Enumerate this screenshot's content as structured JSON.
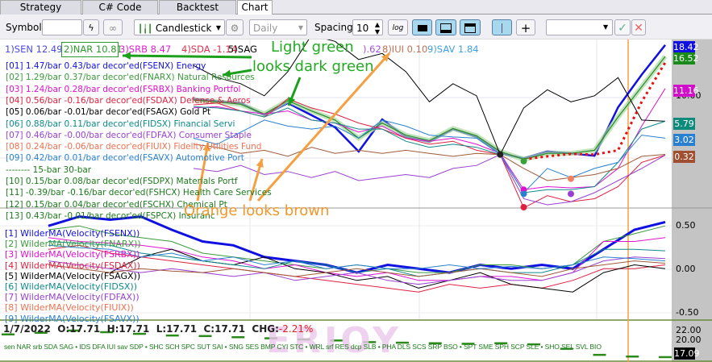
{
  "tabs": [
    {
      "label": "Strategy Settings"
    },
    {
      "label": "C# Code Editor"
    },
    {
      "label": "Backtest Results"
    },
    {
      "label": "Chart",
      "active": true
    }
  ],
  "toolbar": {
    "symbol_label": "Symbol",
    "symbol_value": "",
    "chart_type": "Candlestick",
    "period": "Daily",
    "spacing_label": "Spacing",
    "spacing_value": "10",
    "log_label": "log",
    "right_select": ""
  },
  "top_legend": [
    {
      "text": "1)SEN 12.49",
      "color": "#4a4ae0"
    },
    {
      "text": "2)NAR 10.81",
      "color": "#2a9a2a"
    },
    {
      "text": "3)SRB 8.47",
      "color": "#e020d0"
    },
    {
      "text": "4)SDA -1.14",
      "color": "#e03050"
    },
    {
      "text": "5)SAG",
      "color": "#000000"
    },
    {
      "text": ").62",
      "color": "#a050e0"
    },
    {
      "text": "8)IUI 0.10",
      "color": "#c07050"
    },
    {
      "text": "9)SAV 1.84",
      "color": "#40a0e0"
    }
  ],
  "upper_legend": [
    {
      "text": "[01]  1.47/bar  0.43/bar  decor'ed(FSENX) Energy",
      "color": "#1010e0"
    },
    {
      "text": "[02]  1.29/bar  0.37/bar  decor'ed(FNARX) Natural Resources",
      "color": "#3a9a3a"
    },
    {
      "text": "[03]  1.24/bar  0.28/bar  decor'ed(FSRBX) Banking Portfol",
      "color": "#e010d0"
    },
    {
      "text": "[04]  0.56/bar -0.16/bar  decor'ed(FSDAX) Defense & Aeros",
      "color": "#e02040"
    },
    {
      "text": "[05]  0.06/bar -0.01/bar  decor'ed(FSAGX) Gold Pt",
      "color": "#000000"
    },
    {
      "text": "[06]  0.88/bar  0.11/bar  decor'ed(FIDSX) Financial Servi",
      "color": "#0e8a8a"
    },
    {
      "text": "[07]  0.46/bar -0.00/bar  decor'ed(FDFAX) Consumer Staple",
      "color": "#9a40d0"
    },
    {
      "text": "[08]  0.24/bar -0.06/bar  decor'ed(FIUIX) Fidelity Utilities Fund",
      "color": "#f07050"
    },
    {
      "text": "[09]  0.42/bar  0.01/bar  decor'ed(FSAVX) Automotive Port",
      "color": "#2a80d0"
    },
    {
      "text": "-------- 15-bar    30-bar",
      "color": "#1a7a1a"
    },
    {
      "text": "[10]  0.15/bar  0.08/bar  decor'ed(FSDPX) Materials Portf",
      "color": "#1a7a1a"
    },
    {
      "text": "[11] -0.39/bar -0.16/bar  decor'ed(FSHCX) Health Care Services",
      "color": "#1a7a1a"
    },
    {
      "text": "[12]  0.15/bar  0.04/bar  decor'ed(FSCHX) Chemical Pt",
      "color": "#1a7a1a"
    },
    {
      "text": "[13]  0.43/bar -0.01/bar  decor'ed(FSPCX) Insuranc",
      "color": "#1a7a1a"
    }
  ],
  "lower_legend": [
    {
      "text": "[1] WilderMA(Velocity(FSENX))",
      "color": "#1010e0"
    },
    {
      "text": "[2] WilderMA(Velocity(FNARX))",
      "color": "#3a9a3a"
    },
    {
      "text": "[3] WilderMA(Velocity(FSRBX))",
      "color": "#e010d0"
    },
    {
      "text": "[4] WilderMA(Velocity(FSDAX))",
      "color": "#e02040"
    },
    {
      "text": "[5] WilderMA(Velocity(FSAGX))",
      "color": "#000000"
    },
    {
      "text": "[6] WilderMA(Velocity(FIDSX))",
      "color": "#0e8a8a"
    },
    {
      "text": "[7] WilderMA(Velocity(FDFAX))",
      "color": "#9a40d0"
    },
    {
      "text": "[8] WilderMA(Velocity(FIUIX))",
      "color": "#f07050"
    },
    {
      "text": "[9] WilderMA(Velocity(FSAVX))",
      "color": "#2a80d0"
    }
  ],
  "ohlc": {
    "date": "1/7/2022",
    "open": "O:17.71",
    "high": "H:17.71",
    "low": "L:17.71",
    "close": "C:17.71",
    "chg_label": "CHG:",
    "chg_value": "-2.21%"
  },
  "symbols_line": "sen NAR srb SDA SAG • IDS DFA IUI sav SDP • SHC SCH SPC SUT SAI • SNG SES BMP CYI STC • WRL srf RES dcp SLB • PHA DLS SCS SRP BSO • SPT SME SPH SCP SLE • SHO SEL SVL BIO",
  "watermark": "ERIOY",
  "upper_axis": {
    "labels": [
      "10.00"
    ],
    "tags": [
      {
        "text": "18.42",
        "color": "#1010e0",
        "value": 18.42
      },
      {
        "text": "16.52",
        "color": "#1a8a1a",
        "value": 16.52
      },
      {
        "text": "11.16",
        "color": "#d010c8",
        "value": 11.16
      },
      {
        "text": "5.79",
        "color": "#0e8a7a",
        "value": 5.79
      },
      {
        "text": "3.02",
        "color": "#2a80d0",
        "value": 3.02
      },
      {
        "text": "0.32",
        "color": "#a05030",
        "value": 0.32
      }
    ]
  },
  "lower_axis": {
    "labels": [
      "0.50",
      "0.00",
      "-0.50"
    ]
  },
  "bottom_axis": {
    "labels": [
      "22.00",
      "20.00"
    ],
    "current": "17.09"
  },
  "annotations": {
    "light_green": "Light green",
    "dark_green": "looks dark green",
    "orange_brown": "Orange looks brown"
  },
  "chart_data": {
    "type": "line",
    "upper": {
      "ylim": [
        -8.4,
        19.3
      ],
      "series": [
        {
          "name": "FSENX",
          "color": "#1010e0",
          "width": 2.5,
          "values": [
            9.5,
            9.1,
            8.8,
            6.8,
            8.8,
            6.8,
            4.8,
            0.8,
            6.1,
            3.2,
            2.4,
            4.5,
            3.2,
            0.5,
            -0.3,
            0.8,
            0.5,
            0.1,
            8.1,
            13.5,
            18.4
          ]
        },
        {
          "name": "FNARX",
          "color": "#2a8a2a",
          "width": 1.2,
          "halo": true,
          "values": [
            9.3,
            9.0,
            8.6,
            7.0,
            9.2,
            7.5,
            6.0,
            3.0,
            5.5,
            3.5,
            2.6,
            4.6,
            3.4,
            0.8,
            -0.5,
            0.5,
            0.5,
            1.0,
            6.5,
            11.5,
            16.5
          ]
        },
        {
          "name": "FSRBX",
          "color": "#e010d0",
          "width": 1,
          "values": [
            8.0,
            8.2,
            7.5,
            7.0,
            7.5,
            6.0,
            5.5,
            4.0,
            5.0,
            3.0,
            2.5,
            3.0,
            2.0,
            0.5,
            -5.5,
            -5.0,
            -5.2,
            -5.0,
            -2,
            5,
            11.2
          ]
        },
        {
          "name": "FSDAX",
          "color": "#e02040",
          "width": 1,
          "values": [
            8.5,
            8.8,
            7.5,
            6.5,
            9.5,
            8.0,
            7.0,
            5.5,
            4.5,
            3.0,
            2.0,
            2.5,
            1.0,
            0.3,
            -8.5,
            -6.5,
            -7.5,
            -7.0,
            -5.0,
            -1.0,
            0.2
          ]
        },
        {
          "name": "FSAGX",
          "color": "#000000",
          "width": 1,
          "values": [
            15,
            13,
            12,
            10,
            14,
            20,
            19,
            16,
            17,
            14,
            9,
            12,
            10,
            0.3,
            8,
            11,
            9,
            10,
            13,
            6,
            5.8
          ]
        },
        {
          "name": "FIDSX",
          "color": "#0e8a8a",
          "width": 1,
          "values": [
            8.2,
            8.0,
            7.5,
            6.5,
            8.0,
            6.0,
            5.5,
            4.5,
            4.5,
            2.5,
            1.5,
            2.0,
            1.5,
            0.3,
            -6.0,
            -5.5,
            -5.5,
            -5.0,
            -1.0,
            4.5,
            5.8
          ]
        },
        {
          "name": "FDFAX",
          "color": "#9a40d0",
          "width": 1,
          "values": [
            -2.0,
            -2.5,
            -1.5,
            -3.0,
            -2.5,
            -3.5,
            -2.5,
            -4.0,
            -3.5,
            -3.0,
            -3.5,
            -2.0,
            -1.5,
            0.3,
            -7,
            -8,
            -7.5,
            -6,
            -4,
            -2,
            0.2
          ]
        },
        {
          "name": "FIUIX",
          "color": "#a05a3a",
          "width": 1,
          "values": [
            2,
            1.5,
            0.5,
            1.0,
            0,
            1.5,
            0.5,
            1.0,
            0.5,
            1.0,
            0.5,
            0,
            0.5,
            0.3,
            -2,
            -4,
            -3.5,
            -3,
            -2,
            0,
            0.32
          ]
        },
        {
          "name": "FSAVX",
          "color": "#2a80d0",
          "width": 1,
          "values": [
            3,
            2,
            4,
            6,
            5,
            4.5,
            5,
            3,
            6,
            5,
            3.5,
            3.2,
            3,
            0.3,
            -6,
            -2,
            -3.5,
            -2,
            -1,
            3.5,
            3.0
          ]
        },
        {
          "name": "dotted",
          "color": "#e81010",
          "width": 3,
          "dotted": true,
          "values": [
            null,
            null,
            null,
            null,
            null,
            null,
            null,
            null,
            null,
            null,
            null,
            null,
            null,
            null,
            -0.5,
            0,
            0.4,
            0.3,
            1,
            9,
            15.5
          ]
        }
      ]
    },
    "lower": {
      "ylim": [
        -0.7,
        0.72
      ],
      "series": [
        {
          "name": "FSENX",
          "color": "#1010e0",
          "width": 3,
          "values": [
            0.5,
            0.62,
            0.58,
            0.62,
            0.45,
            0.3,
            0.25,
            0.1,
            0.05,
            0.0,
            -0.1,
            0.0,
            -0.05,
            -0.1,
            0.0,
            -0.05,
            0.0,
            -0.05,
            0.2,
            0.45,
            0.55
          ]
        },
        {
          "name": "FNARX",
          "color": "#3a9a3a",
          "width": 1,
          "values": [
            0.45,
            0.5,
            0.4,
            0.35,
            0.3,
            0.15,
            0.1,
            0.05,
            0.0,
            -0.05,
            0.0,
            -0.05,
            -0.1,
            -0.1,
            0.0,
            0.0,
            -0.05,
            0.0,
            0.3,
            0.4,
            0.5
          ]
        },
        {
          "name": "FSRBX",
          "color": "#e010d0",
          "width": 1,
          "values": [
            0.35,
            0.3,
            0.28,
            0.25,
            0.2,
            0.1,
            0.05,
            -0.05,
            0.0,
            -0.1,
            -0.15,
            -0.1,
            -0.2,
            -0.2,
            -0.15,
            -0.15,
            -0.2,
            -0.1,
            0.3,
            0.3,
            0.35
          ]
        },
        {
          "name": "FSDAX",
          "color": "#e02040",
          "width": 1,
          "values": [
            0.2,
            0.25,
            0.15,
            0.1,
            0.05,
            0.0,
            -0.05,
            -0.1,
            -0.15,
            -0.2,
            -0.25,
            -0.3,
            -0.35,
            -0.25,
            -0.3,
            -0.25,
            -0.3,
            -0.2,
            -0.05,
            -0.05,
            0.0
          ]
        },
        {
          "name": "FSAGX",
          "color": "#000000",
          "width": 1,
          "values": [
            null,
            null,
            -0.1,
            0.1,
            0.2,
            0.05,
            0.0,
            0.1,
            -0.05,
            -0.1,
            -0.2,
            -0.15,
            -0.3,
            -0.2,
            -0.1,
            -0.25,
            -0.3,
            -0.35,
            -0.1,
            0.0,
            -0.05
          ]
        },
        {
          "name": "FIDSX",
          "color": "#0e8a8a",
          "width": 1,
          "values": [
            0.3,
            0.28,
            0.25,
            0.15,
            0.1,
            0.05,
            0.0,
            -0.05,
            0.05,
            0.0,
            -0.1,
            -0.05,
            -0.15,
            -0.1,
            -0.05,
            -0.1,
            -0.1,
            0.0,
            0.2,
            0.2,
            0.18
          ]
        },
        {
          "name": "FDFAX",
          "color": "#9a40d0",
          "width": 1,
          "values": [
            0.05,
            0.0,
            -0.05,
            -0.1,
            -0.05,
            -0.1,
            -0.15,
            -0.1,
            -0.2,
            -0.15,
            -0.1,
            -0.2,
            -0.25,
            -0.2,
            -0.15,
            -0.2,
            -0.2,
            -0.1,
            0.05,
            0.1,
            0.08
          ]
        },
        {
          "name": "FIUIX",
          "color": "#a05a3a",
          "width": 1,
          "values": [
            0.0,
            -0.05,
            -0.1,
            -0.05,
            -0.08,
            -0.1,
            -0.05,
            -0.1,
            -0.15,
            -0.1,
            -0.05,
            -0.1,
            -0.15,
            -0.1,
            -0.05,
            -0.1,
            -0.15,
            -0.05,
            0.0,
            0.05,
            0.02
          ]
        },
        {
          "name": "FSAVX",
          "color": "#2a80d0",
          "width": 1,
          "values": [
            0.25,
            0.22,
            0.2,
            0.1,
            0.15,
            0.05,
            0.1,
            0.0,
            0.05,
            -0.05,
            0.0,
            -0.05,
            -0.05,
            0.0,
            -0.05,
            -0.02,
            -0.05,
            0.0,
            0.1,
            0.08,
            0.05
          ]
        }
      ]
    },
    "price": {
      "ylim": [
        16.5,
        23.5
      ],
      "values": [
        21.2,
        21.5,
        21.9,
        21.6,
        21.3,
        21.0,
        20.9,
        20.7,
        20.5,
        20.3,
        20.1,
        19.8,
        19.7,
        19.6,
        19.5,
        19.6,
        19.4,
        18.6,
        17.5,
        17.2,
        17.09
      ]
    }
  }
}
